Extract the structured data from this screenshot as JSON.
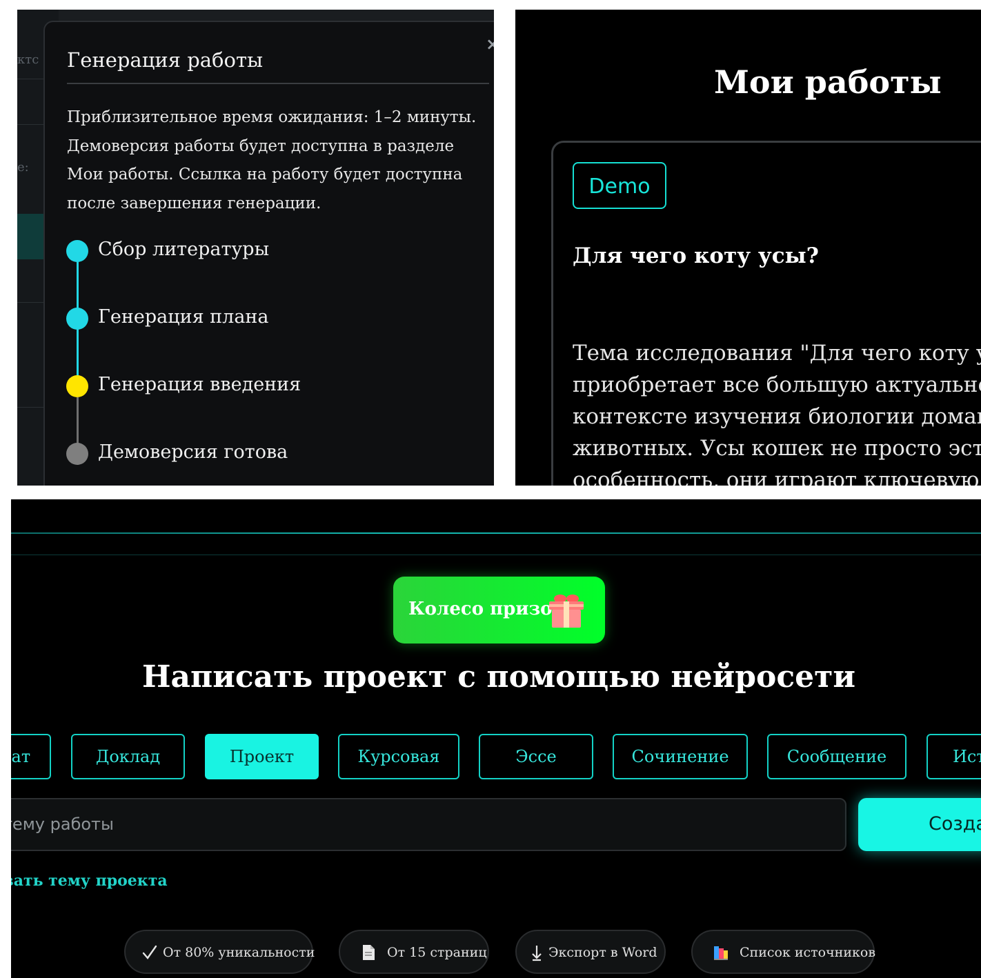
{
  "generation_modal": {
    "background_text": [
      "ктс",
      "е:"
    ],
    "close_glyph": "×",
    "title": "Генерация работы",
    "description": "Приблизительное время ожидания: 1–2 минуты. Демоверсия работы будет доступна в разделе Мои работы. Ссылка на работу будет доступна после завершения генерации.",
    "steps": [
      {
        "label": "Сбор литературы",
        "status": "done",
        "color": "#22d8e6"
      },
      {
        "label": "Генерация плана",
        "status": "done",
        "color": "#22d8e6"
      },
      {
        "label": "Генерация введения",
        "status": "in-progress",
        "color": "#ffe500"
      },
      {
        "label": "Демоверсия готова",
        "status": "pending",
        "color": "#7f7f7f"
      }
    ]
  },
  "my_works": {
    "title": "Мои работы",
    "card": {
      "badge": "Demo",
      "heading": "Для чего коту усы?",
      "text_lines": [
        "Тема исследования \"Для чего коту усы?\"",
        "приобретает все большую актуальность в",
        "контексте изучения биологии домашних",
        "животных. Усы кошек не просто эстетическая",
        "особенность, они играют ключевую роль"
      ]
    }
  },
  "landing": {
    "prize_button": "Колесо призов",
    "title": "Написать проект с помощью нейросети",
    "work_types": [
      {
        "label": "Реферат",
        "active": false
      },
      {
        "label": "Доклад",
        "active": false
      },
      {
        "label": "Проект",
        "active": true
      },
      {
        "label": "Курсовая",
        "active": false
      },
      {
        "label": "Эссе",
        "active": false
      },
      {
        "label": "Сочинение",
        "active": false
      },
      {
        "label": "Сообщение",
        "active": false
      },
      {
        "label": "Истории",
        "active": false
      }
    ],
    "topic_placeholder": "Введите тему работы",
    "create_button": "Создать",
    "suggest_link": "Подсказать тему проекта",
    "features": [
      {
        "label": "От 80% уникальности",
        "icon": "check-icon"
      },
      {
        "label": "От 15 страниц",
        "icon": "document-icon"
      },
      {
        "label": "Экспорт в Word",
        "icon": "download-icon"
      },
      {
        "label": "Список источников",
        "icon": "books-icon"
      }
    ],
    "colors": {
      "accent": "#19f3e2",
      "prize_green": "#00ff29"
    }
  }
}
